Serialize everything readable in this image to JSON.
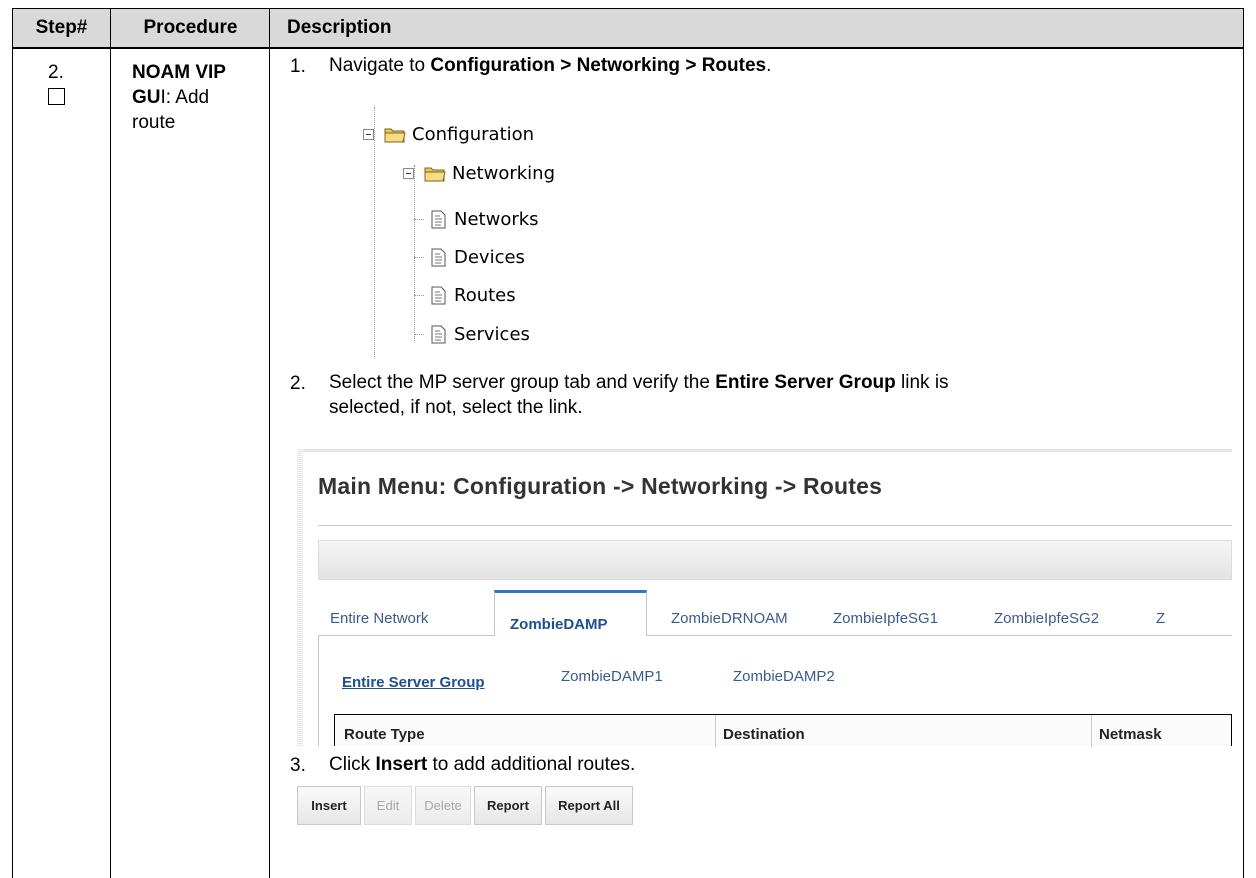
{
  "table": {
    "headers": {
      "step": "Step#",
      "procedure": "Procedure",
      "description": "Description"
    },
    "step_number": "2.",
    "procedure": {
      "bold": "NOAM VIP GU",
      "tail_i": "I",
      "suffix": ": Add route"
    },
    "procedure_line1_bold": "NOAM VIP",
    "procedure_line2_bold": "GU",
    "procedure_line2_rest": "I:  Add",
    "procedure_line3": "route"
  },
  "steps": [
    {
      "num": "1.",
      "pre": "Navigate to ",
      "bold": "Configuration > Networking > Routes",
      "post": "."
    },
    {
      "num": "2.",
      "pre": "Select the MP server group tab and verify the ",
      "bold": "Entire Server Group",
      "post": " link is",
      "line2": "selected, if not, select the link."
    },
    {
      "num": "3.",
      "pre": "Click ",
      "bold": "Insert",
      "post": " to add additional routes."
    }
  ],
  "tree": {
    "root": "Configuration",
    "child": "Networking",
    "leaves": [
      "Networks",
      "Devices",
      "Routes",
      "Services"
    ]
  },
  "gui": {
    "title": "Main Menu: Configuration -> Networking -> Routes",
    "tabs": [
      "Entire Network",
      "ZombieDAMP",
      "ZombieDRNOAM",
      "ZombieIpfeSG1",
      "ZombieIpfeSG2",
      "Z"
    ],
    "active_tab": "ZombieDAMP",
    "subtabs": [
      "Entire Server Group",
      "ZombieDAMP1",
      "ZombieDAMP2"
    ],
    "active_subtab": "Entire Server Group",
    "columns": [
      "Route Type",
      "Destination",
      "Netmask"
    ]
  },
  "buttons": [
    {
      "label": "Insert",
      "enabled": true
    },
    {
      "label": "Edit",
      "enabled": false
    },
    {
      "label": "Delete",
      "enabled": false
    },
    {
      "label": "Report",
      "enabled": true
    },
    {
      "label": "Report All",
      "enabled": true
    }
  ],
  "colors": {
    "header_bg": "#d9d9d9",
    "tab_accent": "#2f76c6",
    "link": "#3b5b8a"
  },
  "icons": [
    "collapse-icon",
    "folder-open-icon",
    "document-icon"
  ]
}
